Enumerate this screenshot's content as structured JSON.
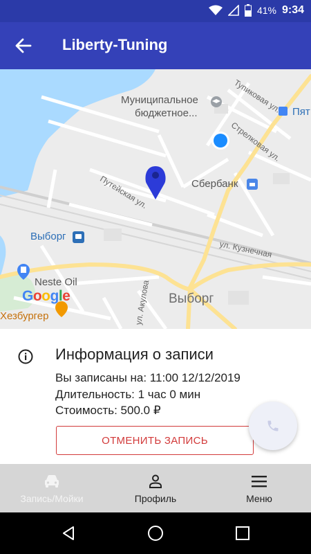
{
  "status_bar": {
    "battery_text": "41%",
    "time": "9:34"
  },
  "app_bar": {
    "title": "Liberty-Tuning"
  },
  "map": {
    "labels": {
      "tupikovaya": "Тупиковая ул.",
      "municipal_line1": "Муниципальное",
      "municipal_line2": "бюджетное...",
      "pyat": "Пят",
      "strelkovaya": "Стрелковая ул.",
      "puteyskaya": "Путейская ул.",
      "sberbank": "Сбербанк",
      "vyborg_station": "Выборг",
      "kuznechnaya": "ул. Кузнечная",
      "neste": "Neste Oil",
      "city": "Выборг",
      "akulova": "ул. Акулова",
      "burger": "Хезбургер"
    },
    "google": {
      "letters": [
        "G",
        "o",
        "o",
        "g",
        "l",
        "e"
      ],
      "colors": [
        "#4285F4",
        "#EA4335",
        "#FBBC05",
        "#4285F4",
        "#34A853",
        "#EA4335"
      ]
    },
    "colors": {
      "water": "#aadaff",
      "road_major": "#fde293",
      "road_minor": "#ffffff",
      "pin": "#2c3bd8",
      "location_dot": "#1a8cff"
    }
  },
  "booking_info": {
    "heading": "Информация о записи",
    "booked_at": "Вы записаны на: 11:00 12/12/2019",
    "duration": "Длительность: 1 час 0 мин",
    "price": "Стоимость: 500.0 ₽",
    "cancel_label": "ОТМЕНИТЬ ЗАПИСЬ"
  },
  "bottom_nav": {
    "items": [
      {
        "label": "Запись/Мойки",
        "icon": "car-icon",
        "enabled": false
      },
      {
        "label": "Профиль",
        "icon": "person-icon",
        "enabled": true
      },
      {
        "label": "Меню",
        "icon": "menu-icon",
        "enabled": true
      }
    ]
  },
  "theme": {
    "primary": "#3441b8",
    "status_bar": "#2b3aa8",
    "cancel_red": "#d23a3a"
  }
}
